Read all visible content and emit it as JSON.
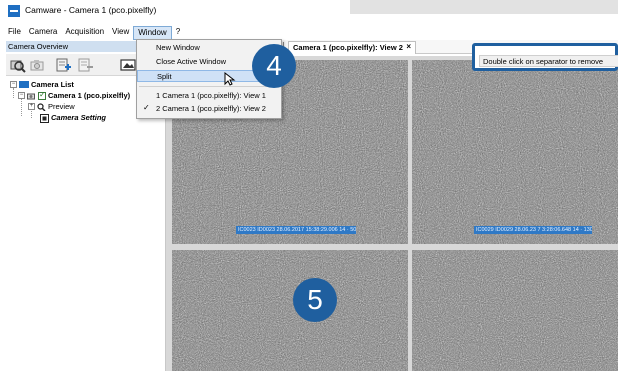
{
  "window": {
    "title": "Camware - Camera 1 (pco.pixelfly)"
  },
  "menubar": {
    "items": [
      "File",
      "Camera",
      "Acquisition",
      "View",
      "Window",
      "?"
    ]
  },
  "left_panel": {
    "header": "Camera Overview",
    "toolbar_icons": [
      "camera-search-icon",
      "camera-icon",
      "add-camera-icon",
      "remove-camera-icon",
      "image-icon"
    ],
    "tree": {
      "root": "Camera List",
      "camera": "Camera 1 (pco.pixelfly)",
      "preview": "Preview",
      "setting": "Camera Setting"
    }
  },
  "window_menu": {
    "items": [
      {
        "label": "New Window"
      },
      {
        "label": "Close Active Window"
      },
      {
        "label": "Split"
      },
      {
        "label": "1 Camera 1 (pco.pixelfly): View 1"
      },
      {
        "label": "2 Camera 1 (pco.pixelfly): View 2"
      }
    ],
    "checked_mark": "✓"
  },
  "tab": {
    "label": "Camera 1 (pco.pixelfly): View 2",
    "close": "×"
  },
  "hint": {
    "text": "Double click on separator to remove"
  },
  "callouts": {
    "step4": "4",
    "step5": "5"
  },
  "views": {
    "status_top_left": "IC0023 ID0023 28.06.2017 15:38:29.006   14 · 502 µs",
    "status_top_right": "IC0029 ID0029 28.06.23 7   3:28:06.648   14 · 1302 µs"
  },
  "colors": {
    "accent": "#1f5f9f",
    "selection": "#cfe1f6",
    "status_strip": "#2f79c6"
  }
}
